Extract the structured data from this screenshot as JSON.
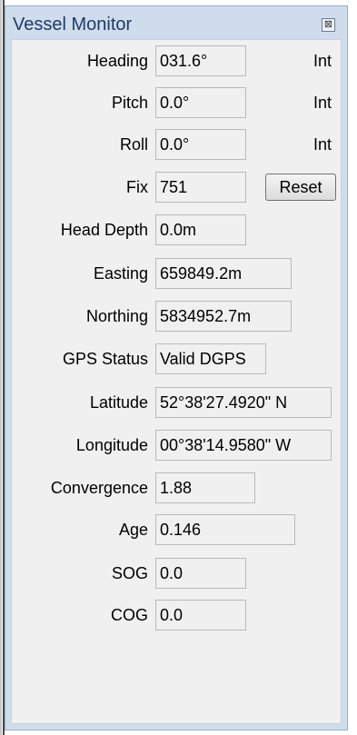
{
  "window": {
    "title": "Vessel Monitor",
    "close_glyph": "⊠"
  },
  "rows": [
    {
      "label": "Heading",
      "value": "031.6°",
      "mode": "Int"
    },
    {
      "label": "Pitch",
      "value": "0.0°",
      "mode": "Int"
    },
    {
      "label": "Roll",
      "value": "0.0°",
      "mode": "Int"
    },
    {
      "label": "Fix",
      "value": "751",
      "button": "Reset"
    },
    {
      "label": "Head Depth",
      "value": "0.0m"
    },
    {
      "label": "Easting",
      "value": "659849.2m"
    },
    {
      "label": "Northing",
      "value": "5834952.7m"
    },
    {
      "label": "GPS Status",
      "value": "Valid DGPS"
    },
    {
      "label": "Latitude",
      "value": "52°38'27.4920\" N"
    },
    {
      "label": "Longitude",
      "value": "00°38'14.9580\" W"
    },
    {
      "label": "Convergence",
      "value": "1.88"
    },
    {
      "label": "Age",
      "value": "0.146"
    },
    {
      "label": "SOG",
      "value": "0.0"
    },
    {
      "label": "COG",
      "value": "0.0"
    }
  ]
}
